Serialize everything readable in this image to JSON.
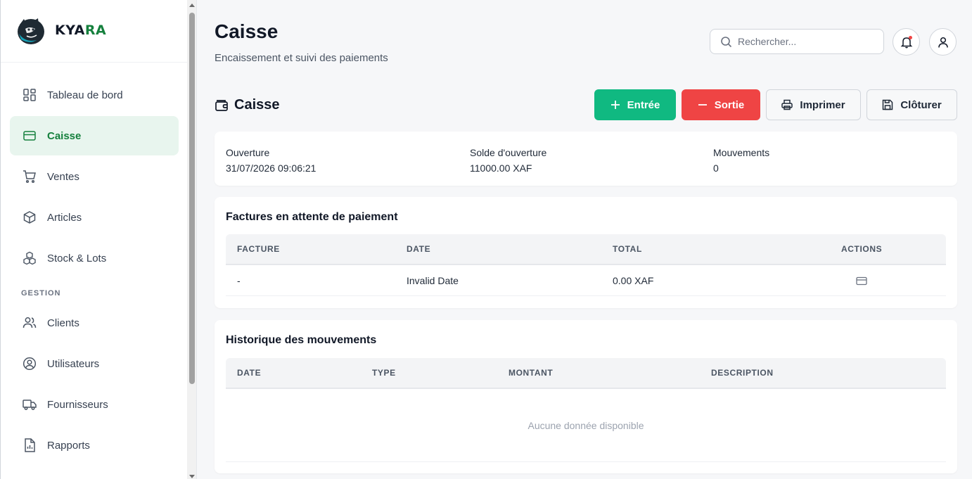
{
  "brand": {
    "part1": "KYA",
    "part2": "RA"
  },
  "sidebar": {
    "items": [
      {
        "label": "Tableau de bord",
        "icon": "dashboard-icon"
      },
      {
        "label": "Caisse",
        "icon": "card-icon",
        "active": true
      },
      {
        "label": "Ventes",
        "icon": "cart-icon"
      },
      {
        "label": "Articles",
        "icon": "box-icon"
      },
      {
        "label": "Stock & Lots",
        "icon": "boxes-icon"
      }
    ],
    "section": "GESTION",
    "items2": [
      {
        "label": "Clients",
        "icon": "users-icon"
      },
      {
        "label": "Utilisateurs",
        "icon": "user-circle-icon"
      },
      {
        "label": "Fournisseurs",
        "icon": "truck-icon"
      },
      {
        "label": "Rapports",
        "icon": "report-icon"
      }
    ]
  },
  "header": {
    "title": "Caisse",
    "subtitle": "Encaissement et suivi des paiements",
    "search_placeholder": "Rechercher..."
  },
  "section": {
    "title": "Caisse",
    "buttons": {
      "entree": "Entrée",
      "sortie": "Sortie",
      "imprimer": "Imprimer",
      "cloturer": "Clôturer"
    }
  },
  "info": {
    "ouverture_label": "Ouverture",
    "ouverture_value": "31/07/2026 09:06:21",
    "solde_label": "Solde d'ouverture",
    "solde_value": "11000.00 XAF",
    "mouvements_label": "Mouvements",
    "mouvements_value": "0"
  },
  "factures": {
    "title": "Factures en attente de paiement",
    "columns": [
      "FACTURE",
      "DATE",
      "TOTAL",
      "ACTIONS"
    ],
    "rows": [
      {
        "facture": "-",
        "date": "Invalid Date",
        "total": "0.00 XAF"
      }
    ]
  },
  "historique": {
    "title": "Historique des mouvements",
    "columns": [
      "DATE",
      "TYPE",
      "MONTANT",
      "DESCRIPTION"
    ],
    "empty": "Aucune donnée disponible"
  },
  "colors": {
    "accent": "#10b981",
    "danger": "#ef4444",
    "active_bg": "#e8f5ee",
    "active_text": "#15803d"
  }
}
